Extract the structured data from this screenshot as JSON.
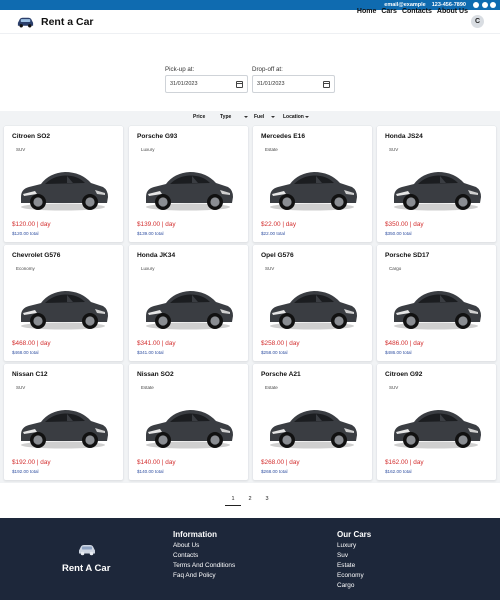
{
  "topbar": {
    "email": "email@example",
    "phone": "123-456-7890",
    "social_icons": [
      "facebook-icon",
      "instagram-icon",
      "github-icon"
    ]
  },
  "brand": {
    "name": "Rent a Car",
    "logo_icon": "car-icon"
  },
  "nav": {
    "items": [
      "Home",
      "Cars",
      "Contacts",
      "About Us"
    ],
    "avatar_initial": "C"
  },
  "search": {
    "pickup_label": "Pick-up at:",
    "pickup_value": "31/01/2023",
    "dropoff_label": "Drop-off at:",
    "dropoff_value": "31/01/2023"
  },
  "filters": {
    "items": [
      {
        "label": "Price",
        "dropdown": false
      },
      {
        "label": "Type",
        "dropdown": true
      },
      {
        "label": "Fuel",
        "dropdown": true
      },
      {
        "label": "Location",
        "dropdown": true
      }
    ]
  },
  "cars": [
    {
      "name": "Citroen SO2",
      "category": "SUV",
      "price": "$120.00 | day",
      "total": "$120.00 total"
    },
    {
      "name": "Porsche G93",
      "category": "Luxury",
      "price": "$139.00 | day",
      "total": "$139.00 total"
    },
    {
      "name": "Mercedes E16",
      "category": "Estate",
      "price": "$22.00 | day",
      "total": "$22.00 total"
    },
    {
      "name": "Honda JS24",
      "category": "SUV",
      "price": "$350.00 | day",
      "total": "$350.00 total"
    },
    {
      "name": "Chevrolet G576",
      "category": "Economy",
      "price": "$468.00 | day",
      "total": "$468.00 total"
    },
    {
      "name": "Honda JK34",
      "category": "Luxury",
      "price": "$341.00 | day",
      "total": "$341.00 total"
    },
    {
      "name": "Opel G576",
      "category": "SUV",
      "price": "$258.00 | day",
      "total": "$258.00 total"
    },
    {
      "name": "Porsche SD17",
      "category": "Cargo",
      "price": "$486.00 | day",
      "total": "$486.00 total"
    },
    {
      "name": "Nissan C12",
      "category": "SUV",
      "price": "$192.00 | day",
      "total": "$192.00 total"
    },
    {
      "name": "Nissan SO2",
      "category": "Estate",
      "price": "$140.00 | day",
      "total": "$140.00 total"
    },
    {
      "name": "Porsche A21",
      "category": "Estate",
      "price": "$268.00 | day",
      "total": "$268.00 total"
    },
    {
      "name": "Citroen G92",
      "category": "SUV",
      "price": "$162.00 | day",
      "total": "$162.00 total"
    }
  ],
  "pagination": {
    "pages": [
      "1",
      "2",
      "3"
    ],
    "active": "1"
  },
  "footer": {
    "brand": "Rent A Car",
    "info_heading": "Information",
    "info_links": [
      "About Us",
      "Contacts",
      "Terms And Conditions",
      "Faq And Policy"
    ],
    "cars_heading": "Our Cars",
    "cars_links": [
      "Luxury",
      "Suv",
      "Estate",
      "Economy",
      "Cargo"
    ]
  },
  "colors": {
    "topbar": "#0f6bb0",
    "price": "#d32f2f",
    "total": "#2e4ea0",
    "footer": "#1d273a",
    "card_area": "#f1f3f5"
  }
}
